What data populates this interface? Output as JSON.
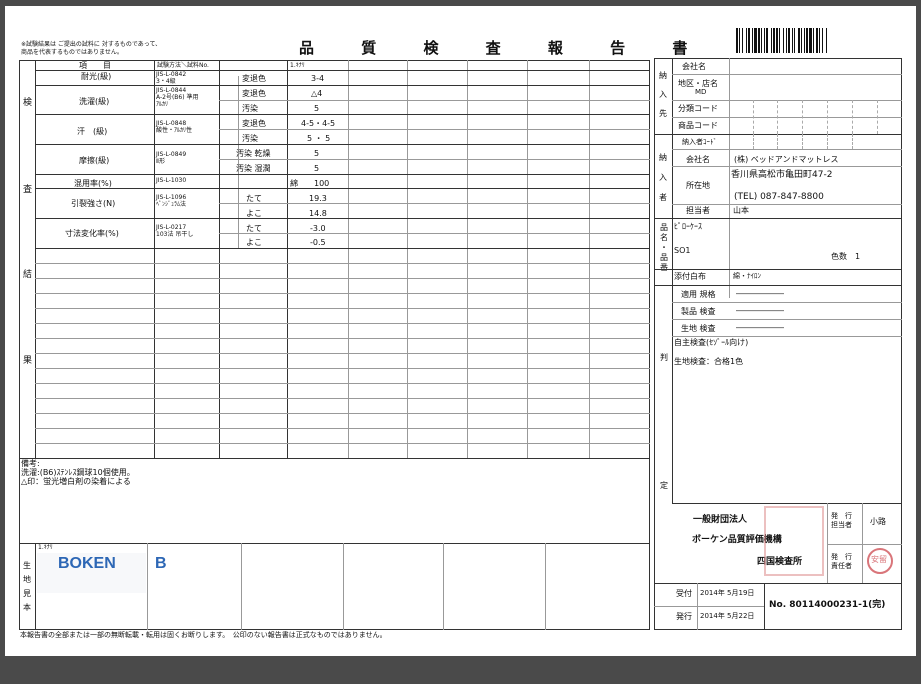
{
  "note_top": [
    "※試験結果は ご提出の試料に 対するものであって、",
    "商品を代表するものではありません。"
  ],
  "title": "品 質 検 査 報 告 書",
  "left_vertical_label": [
    "検",
    "査",
    "結",
    "果"
  ],
  "table_header": {
    "item": "項　　目",
    "method": "試験方法＼試料No.",
    "sample": "1.ｷﾅﾘ"
  },
  "rows": [
    {
      "item": "耐光(級)",
      "method": [
        "JIS-L-0842",
        "3・4級"
      ],
      "props": [
        {
          "label": "変退色",
          "value": "3-4"
        }
      ]
    },
    {
      "item": "洗濯(級)",
      "method": [
        "JIS-L-0844",
        "A-2号(B6) 準用",
        "ｱﾙｶﾘ"
      ],
      "props": [
        {
          "label": "変退色",
          "value": "△4"
        },
        {
          "label": "汚染",
          "value": "5"
        }
      ]
    },
    {
      "item": "汗　(級)",
      "method": [
        "JIS-L-0848",
        "酸性・ｱﾙｶﾘ性"
      ],
      "props": [
        {
          "label": "変退色",
          "value": "4-5・4-5"
        },
        {
          "label": "汚染",
          "value": "5 ・ 5"
        }
      ]
    },
    {
      "item": "摩擦(級)",
      "method": [
        "JIS-L-0849",
        "Ⅱ形"
      ],
      "props": [
        {
          "label": "汚染 乾燥",
          "value": "5"
        },
        {
          "label": "汚染 湿潤",
          "value": "5"
        }
      ]
    },
    {
      "item": "混用率(%)",
      "method": [
        "JIS-L-1030"
      ],
      "props": [
        {
          "label": "",
          "value": "綿　　100"
        }
      ]
    },
    {
      "item": "引裂強さ(N)",
      "method": [
        "JIS-L-1096",
        "ﾍﾟﾝｼﾞｭﾗﾑ法"
      ],
      "props": [
        {
          "label": "たて",
          "value": "19.3"
        },
        {
          "label": "よこ",
          "value": "14.8"
        }
      ]
    },
    {
      "item": "寸法変化率(%)",
      "method": [
        "JIS-L-0217",
        "103法 吊干し"
      ],
      "props": [
        {
          "label": "たて",
          "value": "-3.0"
        },
        {
          "label": "よこ",
          "value": "-0.5"
        }
      ]
    }
  ],
  "remarks": {
    "label": "備考:",
    "lines": [
      "洗濯:(B6)ｽﾃﾝﾚｽ鋼球10個使用。",
      "△印：蛍光増白剤の染着による"
    ]
  },
  "sample_section": {
    "vertical": [
      "生",
      "地",
      "見",
      "本"
    ],
    "sample_no": "1.ｷﾅﾘ",
    "logo": "BOKEN",
    "logo_cut": "B"
  },
  "footer_note": "本報告書の全部または一部の無断転載・転用は固くお断りします。　公印のない報告書は正式なものではありません。",
  "right": {
    "delivery_vertical": [
      "納",
      "入",
      "先"
    ],
    "delivery": [
      {
        "label": "会社名",
        "value": ""
      },
      {
        "label": "地区・店名",
        "value": "MD"
      },
      {
        "label": "分類コード",
        "value": ""
      },
      {
        "label": "商品コード",
        "value": ""
      }
    ],
    "supplier_code_label": "納入者ｺｰﾄﾞ",
    "supplier_vertical": [
      "納",
      "入",
      "者"
    ],
    "supplier": [
      {
        "label": "会社名",
        "value": "(株) ベッドアンドマットレス"
      },
      {
        "label": "所在地",
        "value": "香川県高松市亀田町47-2"
      },
      {
        "label": "",
        "value": "(TEL) 087-847-8800"
      },
      {
        "label": "担当者",
        "value": "山本"
      }
    ],
    "product_vertical": [
      "品",
      "名",
      "・",
      "品",
      "番"
    ],
    "product_name": "ﾋﾟﾛｰｹｰｽ",
    "product_no": "SO1",
    "color_count": "色数　1",
    "attached_label": "添付白布",
    "attached_value": "綿・ﾅｲﾛﾝ",
    "judgement_vertical": [
      "判",
      "定"
    ],
    "judgement_items": [
      "適用 規格",
      "製品 検査",
      "生地 検査"
    ],
    "judgement_dash": "――――――",
    "self_inspection": "自主検査(ｾｿﾞｰﾙ向け)",
    "fabric_result": "生地検査：合格1色",
    "org": [
      "一般財団法人",
      "ボーケン品質評価機構",
      "四国検査所"
    ],
    "issuer_label": [
      "発　行",
      "担当者"
    ],
    "issuer_name": "小路",
    "responsible_label": [
      "発　行",
      "責任者"
    ],
    "seal_text": "安留",
    "received_label": "受付",
    "received_date": "2014年 5月19日",
    "issued_label": "発行",
    "issued_date": "2014年 5月22日",
    "report_no": "No. 80114000231-1(完)"
  }
}
